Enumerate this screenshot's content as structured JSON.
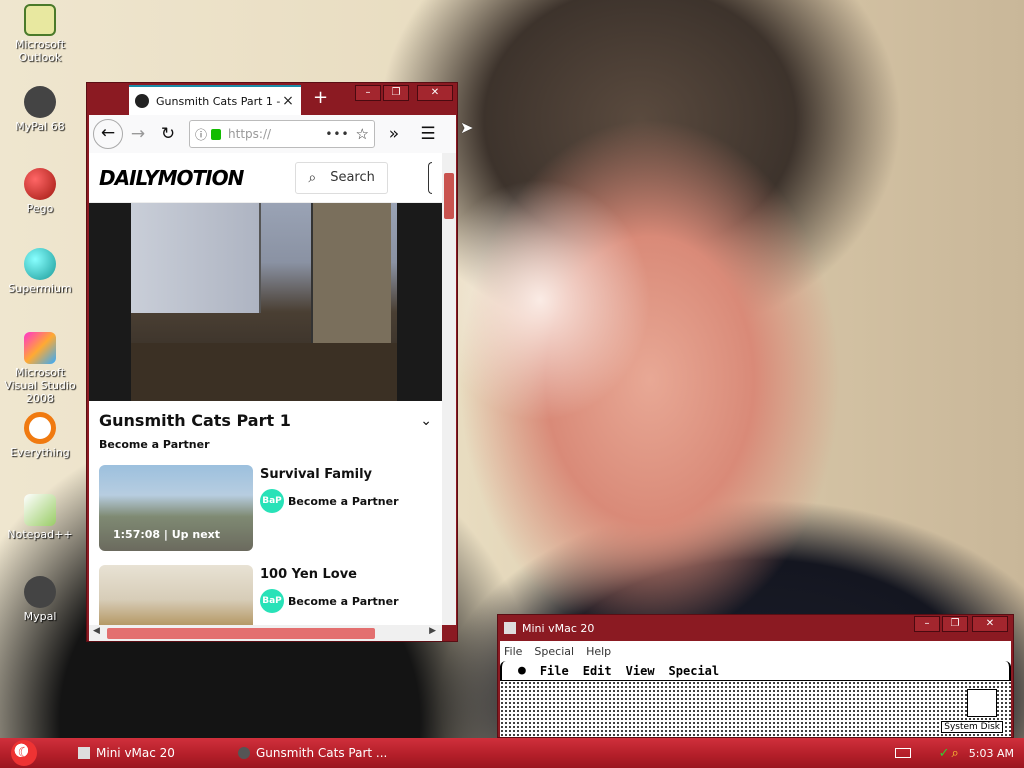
{
  "desktop_icons": [
    {
      "label": "Microsoft Outlook",
      "icon": "outlook-icon",
      "color": "#e8e8a0"
    },
    {
      "label": "MyPal 68",
      "icon": "mypal-icon",
      "color": "#444444"
    },
    {
      "label": "Pego",
      "icon": "pego-icon",
      "color": "#c0301a"
    },
    {
      "label": "Supermium",
      "icon": "supermium-icon",
      "color": "#28b8b0"
    },
    {
      "label": "Microsoft Visual Studio 2008",
      "icon": "visual-studio-icon",
      "color": "#d05cd0"
    },
    {
      "label": "Everything",
      "icon": "everything-icon",
      "color": "#f07a10"
    },
    {
      "label": "Notepad++",
      "icon": "notepadpp-icon",
      "color": "#7cc048"
    },
    {
      "label": "Mypal",
      "icon": "mypal-icon",
      "color": "#444444"
    }
  ],
  "browser": {
    "tab_title": "Gunsmith Cats Part 1 - v",
    "tab_close": "×",
    "new_tab": "+",
    "url": "https://",
    "page_actions": "•••",
    "window_controls": {
      "min": "–",
      "max": "❐",
      "close": "✕"
    }
  },
  "dailymotion": {
    "logo": "DAILYMOTION",
    "search_label": "Search",
    "video_title": "Gunsmith Cats Part 1",
    "channel": "Become a Partner",
    "related": [
      {
        "title": "Survival Family",
        "duration": "1:57:08 | Up next",
        "channel": "Become a Partner",
        "avatar": "BaP"
      },
      {
        "title": "100 Yen Love",
        "duration": "",
        "channel": "Become a Partner",
        "avatar": "BaP"
      }
    ]
  },
  "vmac": {
    "title": "Mini vMac 20",
    "menu": [
      "File",
      "Special",
      "Help"
    ],
    "mac_menu": [
      "File",
      "Edit",
      "View",
      "Special"
    ],
    "apple": "",
    "disk_label": "System Disk"
  },
  "taskbar": {
    "items": [
      {
        "label": "Mini vMac 20"
      },
      {
        "label": "Gunsmith Cats Part ..."
      }
    ],
    "clock": "5:03 AM"
  }
}
